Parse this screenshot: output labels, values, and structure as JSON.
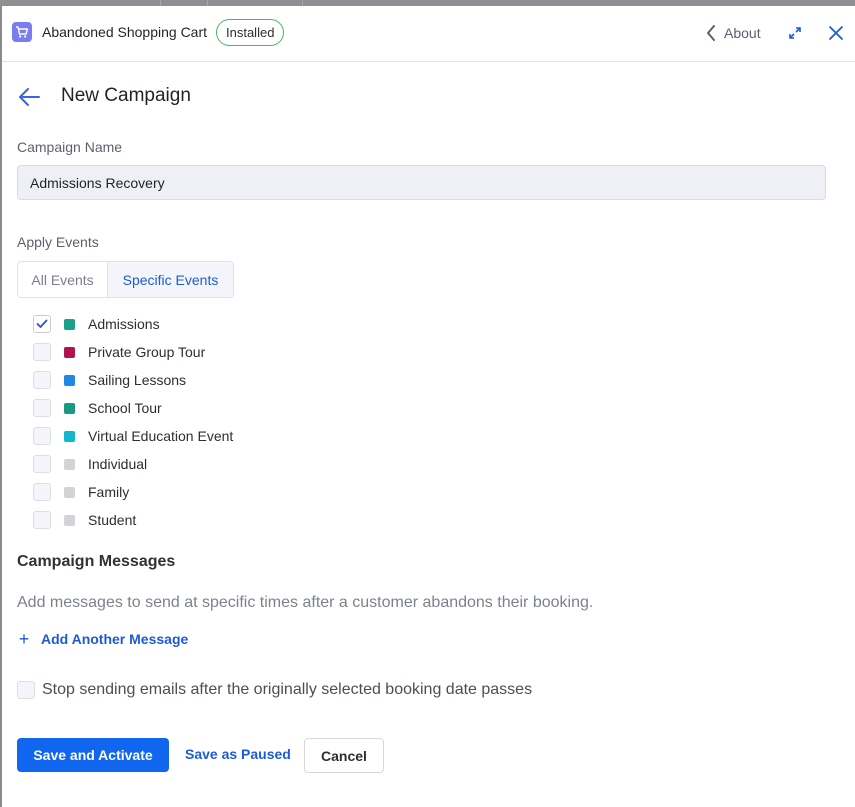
{
  "header": {
    "app_title": "Abandoned Shopping Cart",
    "badge": "Installed",
    "about_label": "About",
    "icons": {
      "app": "shopping-cart-icon",
      "about": "chevron-left-icon",
      "expand": "expand-icon",
      "close": "close-icon"
    }
  },
  "page": {
    "title": "New Campaign"
  },
  "campaign_name": {
    "label": "Campaign Name",
    "value": "Admissions Recovery"
  },
  "apply_events": {
    "label": "Apply Events",
    "options": [
      "All Events",
      "Specific Events"
    ],
    "selected": "Specific Events",
    "events": [
      {
        "name": "Admissions",
        "color": "#1aa08a",
        "checked": true
      },
      {
        "name": "Private Group Tour",
        "color": "#b0144f",
        "checked": false
      },
      {
        "name": "Sailing Lessons",
        "color": "#1e88e5",
        "checked": false
      },
      {
        "name": "School Tour",
        "color": "#1a9a86",
        "checked": false
      },
      {
        "name": "Virtual Education Event",
        "color": "#12b6cf",
        "checked": false
      },
      {
        "name": "Individual",
        "color": "#d2d3d6",
        "checked": false
      },
      {
        "name": "Family",
        "color": "#d2d3d6",
        "checked": false
      },
      {
        "name": "Student",
        "color": "#d2d3d6",
        "checked": false
      }
    ]
  },
  "messages": {
    "title": "Campaign Messages",
    "description": "Add messages to send at specific times after a customer abandons their booking.",
    "add_label": "Add Another Message"
  },
  "stop_option": {
    "label": "Stop sending emails after the originally selected booking date passes",
    "checked": false
  },
  "actions": {
    "primary": "Save and Activate",
    "secondary": "Save as Paused",
    "cancel": "Cancel"
  },
  "colors": {
    "accent": "#1166f0",
    "link": "#1d5bd6",
    "badge_border": "#4cb368"
  }
}
